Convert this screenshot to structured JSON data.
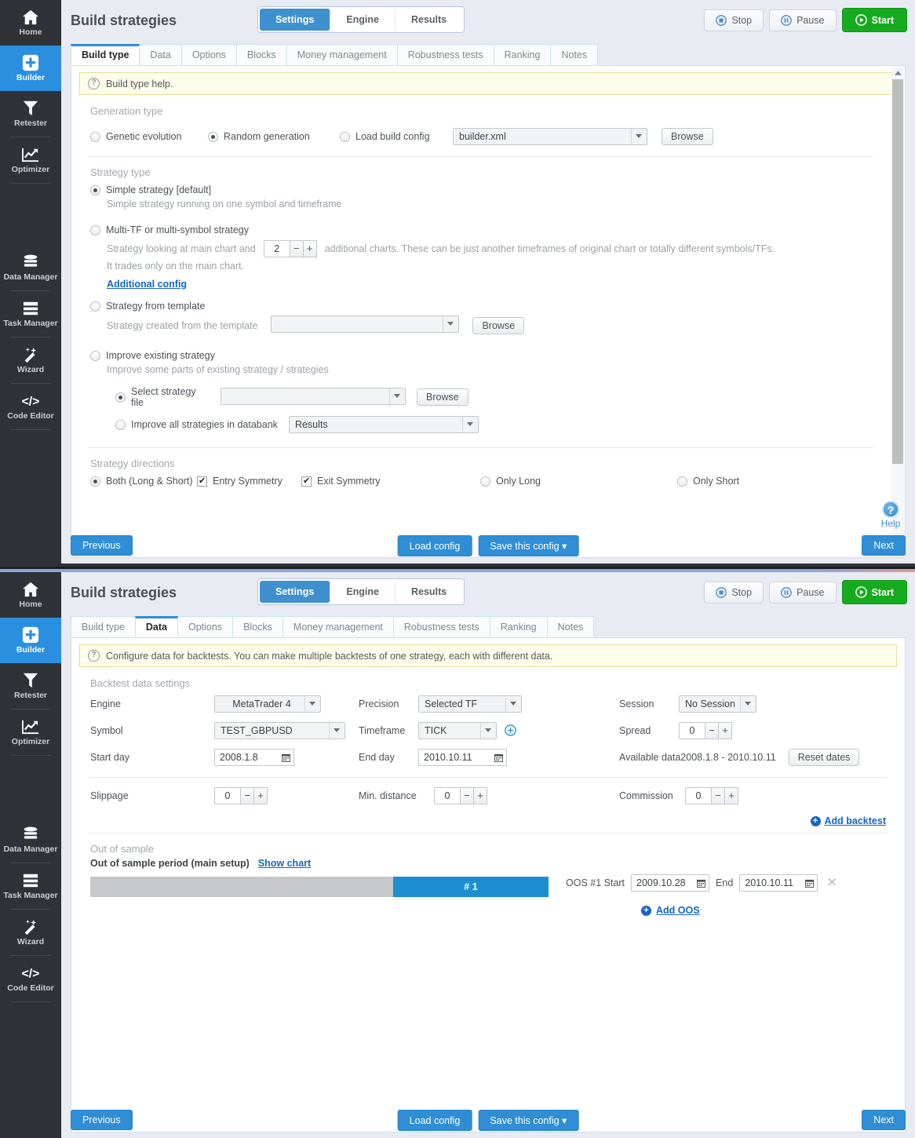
{
  "sidebar": {
    "items": [
      {
        "label": "Home",
        "icon": "home-icon",
        "active": false
      },
      {
        "label": "Builder",
        "icon": "plus-icon",
        "active": true
      },
      {
        "label": "Retester",
        "icon": "funnel-icon",
        "active": false
      },
      {
        "label": "Optimizer",
        "icon": "chart-up-icon",
        "active": false
      },
      {
        "label": "Data Manager",
        "icon": "database-icon",
        "active": false
      },
      {
        "label": "Task Manager",
        "icon": "list-icon",
        "active": false
      },
      {
        "label": "Wizard",
        "icon": "magic-wand-icon",
        "active": false
      },
      {
        "label": "Code Editor",
        "icon": "code-brackets-icon",
        "active": false
      }
    ]
  },
  "header": {
    "title": "Build strategies",
    "segments": [
      {
        "label": "Settings",
        "active": true
      },
      {
        "label": "Engine",
        "active": false
      },
      {
        "label": "Results",
        "active": false
      }
    ],
    "run_buttons": [
      {
        "label": "Stop",
        "icon": "stop-icon"
      },
      {
        "label": "Pause",
        "icon": "pause-icon"
      },
      {
        "label": "Start",
        "icon": "play-icon"
      }
    ]
  },
  "tabs": [
    {
      "label": "Build type"
    },
    {
      "label": "Data"
    },
    {
      "label": "Options"
    },
    {
      "label": "Blocks"
    },
    {
      "label": "Money management"
    },
    {
      "label": "Robustness tests"
    },
    {
      "label": "Ranking"
    },
    {
      "label": "Notes"
    }
  ],
  "top_window": {
    "active_tab": "Build type",
    "help_text": "Build type help.",
    "generation_type": {
      "title": "Generation type",
      "options": [
        {
          "label": "Genetic evolution",
          "selected": false
        },
        {
          "label": "Random generation",
          "selected": true
        },
        {
          "label": "Load build config",
          "selected": false
        }
      ],
      "config_file": "builder.xml",
      "browse_label": "Browse"
    },
    "strategy_type": {
      "title": "Strategy type",
      "simple": {
        "label": "Simple strategy [default]",
        "desc": "Simple strategy running on one symbol and timeframe",
        "selected": true
      },
      "multi": {
        "label": "Multi-TF or multi-symbol strategy",
        "desc_before": "Strategy looking at main chart and",
        "charts_count": "2",
        "desc_after": "additional charts. These can be just another timeframes of original chart or totally different symbols/TFs.",
        "desc_line2": "It trades only on the main chart.",
        "additional_config_link": "Additional config",
        "selected": false
      },
      "template": {
        "label": "Strategy from template",
        "desc": "Strategy created from the template",
        "value": "",
        "browse_label": "Browse",
        "selected": false
      },
      "improve": {
        "label": "Improve existing strategy",
        "desc": "Improve some parts of existing strategy / strategies",
        "selected": false,
        "select_file": {
          "label": "Select strategy file",
          "value": "",
          "browse_label": "Browse",
          "selected": true
        },
        "databank": {
          "label": "Improve all strategies in databank",
          "value": "Results",
          "selected": false
        }
      }
    },
    "strategy_directions": {
      "title": "Strategy directions",
      "both": {
        "label": "Both (Long & Short)",
        "selected": true
      },
      "entry_symmetry": {
        "label": "Entry Symmetry",
        "checked": true
      },
      "exit_symmetry": {
        "label": "Exit Symmetry",
        "checked": true
      },
      "only_long": {
        "label": "Only Long",
        "selected": false
      },
      "only_short": {
        "label": "Only Short",
        "selected": false
      }
    },
    "help_badge": {
      "symbol": "?",
      "label": "Help"
    },
    "footer": {
      "previous": "Previous",
      "load_config": "Load config",
      "save_config": "Save this config",
      "next": "Next"
    }
  },
  "bottom_window": {
    "active_tab": "Data",
    "help_text": "Configure data for backtests. You can make multiple backtests of one strategy, each with different data.",
    "backtest": {
      "title": "Backtest data settings",
      "engine": {
        "label": "Engine",
        "value": "MetaTrader 4"
      },
      "symbol": {
        "label": "Symbol",
        "value": "TEST_GBPUSD"
      },
      "start_day": {
        "label": "Start day",
        "value": "2008.1.8"
      },
      "precision": {
        "label": "Precision",
        "value": "Selected TF"
      },
      "timeframe": {
        "label": "Timeframe",
        "value": "TICK"
      },
      "end_day": {
        "label": "End day",
        "value": "2010.10.11"
      },
      "session": {
        "label": "Session",
        "value": "No Session"
      },
      "spread": {
        "label": "Spread",
        "value": "0"
      },
      "available_data": "Available data2008.1.8 - 2010.10.11",
      "reset_dates": "Reset dates",
      "slippage": {
        "label": "Slippage",
        "value": "0"
      },
      "min_distance": {
        "label": "Min. distance",
        "value": "0"
      },
      "commission": {
        "label": "Commission",
        "value": "0"
      },
      "add_backtest": "Add backtest"
    },
    "out_of_sample": {
      "title": "Out of sample",
      "period_label": "Out of sample period (main setup)",
      "show_chart": "Show chart",
      "bar_label": "# 1",
      "oos_start_label": "OOS #1 Start",
      "oos_start_value": "2009.10.28",
      "oos_end_label": "End",
      "oos_end_value": "2010.10.11",
      "add_oos": "Add OOS"
    },
    "footer": {
      "previous": "Previous",
      "load_config": "Load config",
      "save_config": "Save this config",
      "next": "Next"
    }
  },
  "colors": {
    "accent": "#2f8ed6",
    "start_green": "#16ab1f",
    "sidebar": "#2f3337",
    "help_yellow": "#fefdea"
  }
}
